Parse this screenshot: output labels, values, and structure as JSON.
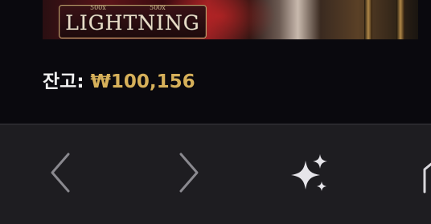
{
  "banner": {
    "logo_text": "LIGHTNING",
    "logo_badges": [
      "500x",
      "500x"
    ]
  },
  "balance": {
    "label": "잔고:",
    "amount": "₩100,156",
    "amount_color": "#d6b05a"
  },
  "toolbar": {
    "back_icon": "chevron-left-icon",
    "forward_icon": "chevron-right-icon",
    "ai_icon": "sparkles-icon",
    "home_icon": "home-icon"
  }
}
